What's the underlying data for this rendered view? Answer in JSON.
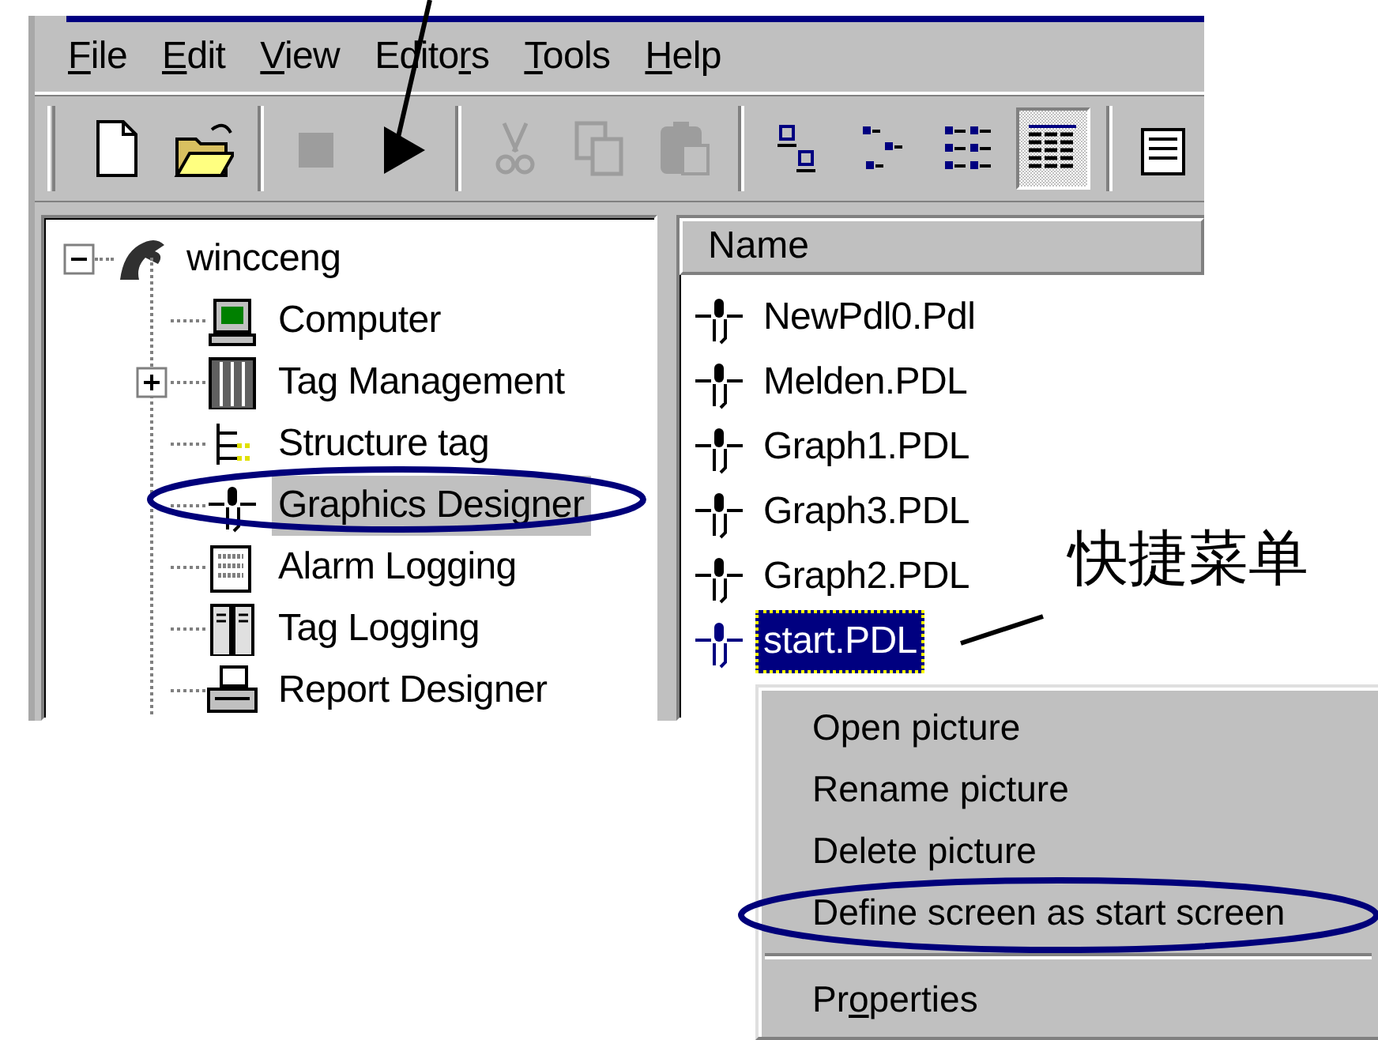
{
  "menu_bar": [
    {
      "key": "F",
      "post": "ile"
    },
    {
      "key": "E",
      "post": "dit"
    },
    {
      "key": "V",
      "post": "iew"
    },
    {
      "pre": "Edito",
      "key": "r",
      "post": "s"
    },
    {
      "key": "T",
      "post": "ools"
    },
    {
      "key": "H",
      "post": "elp"
    }
  ],
  "toolbar": [
    {
      "kind": "grip"
    },
    {
      "kind": "button",
      "disabled": false,
      "pressed": false
    },
    {
      "kind": "button",
      "disabled": false,
      "pressed": false
    },
    {
      "kind": "separator"
    },
    {
      "kind": "button",
      "disabled": true,
      "pressed": false
    },
    {
      "kind": "button",
      "disabled": false,
      "pressed": false
    },
    {
      "kind": "separator"
    },
    {
      "kind": "button",
      "disabled": true,
      "pressed": false
    },
    {
      "kind": "button",
      "disabled": true,
      "pressed": false
    },
    {
      "kind": "button",
      "disabled": true,
      "pressed": false
    },
    {
      "kind": "separator"
    },
    {
      "kind": "button",
      "disabled": false,
      "pressed": false
    },
    {
      "kind": "button",
      "disabled": false,
      "pressed": false
    },
    {
      "kind": "button",
      "disabled": false,
      "pressed": false
    },
    {
      "kind": "button",
      "disabled": false,
      "pressed": true
    },
    {
      "kind": "separator"
    },
    {
      "kind": "button",
      "disabled": false,
      "pressed": false
    }
  ],
  "tree": {
    "label": "wincceng",
    "expanded": true,
    "selected": false,
    "children": [
      {
        "label": "Computer",
        "selected": false
      },
      {
        "label": "Tag Management",
        "expanded": false,
        "selected": false
      },
      {
        "label": "Structure tag",
        "selected": false
      },
      {
        "label": "Graphics Designer",
        "selected": true
      },
      {
        "label": "Alarm Logging",
        "selected": false
      },
      {
        "label": "Tag Logging",
        "selected": false
      },
      {
        "label": "Report Designer",
        "selected": false
      }
    ]
  },
  "file_list": {
    "columns": [
      "Name"
    ],
    "rows": [
      {
        "name": "NewPdl0.Pdl",
        "selected": false
      },
      {
        "name": "Melden.PDL",
        "selected": false
      },
      {
        "name": "Graph1.PDL",
        "selected": false
      },
      {
        "name": "Graph3.PDL",
        "selected": false
      },
      {
        "name": "Graph2.PDL",
        "selected": false
      },
      {
        "name": "start.PDL",
        "selected": true
      }
    ]
  },
  "context_menu": [
    {
      "kind": "item",
      "pre": "Open picture"
    },
    {
      "kind": "item",
      "pre": "Rename picture"
    },
    {
      "kind": "item",
      "pre": "Delete picture"
    },
    {
      "kind": "item",
      "pre": "Define screen as start screen"
    },
    {
      "kind": "separator"
    },
    {
      "kind": "item",
      "pre": "Pr",
      "key": "o",
      "post": "perties"
    }
  ],
  "callout": {
    "text": "快捷菜单"
  }
}
